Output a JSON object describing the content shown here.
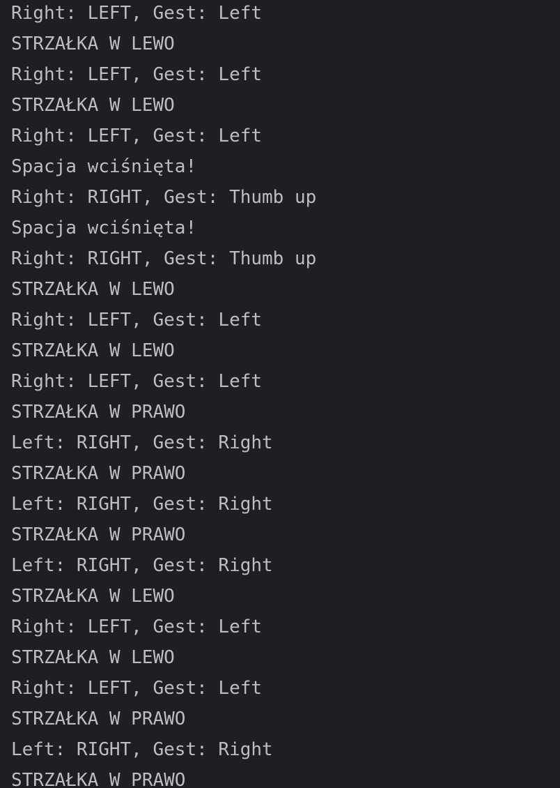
{
  "console": {
    "lines": [
      "Right: LEFT, Gest: Left",
      "STRZAŁKA W LEWO",
      "Right: LEFT, Gest: Left",
      "STRZAŁKA W LEWO",
      "Right: LEFT, Gest: Left",
      "Spacja wciśnięta!",
      "Right: RIGHT, Gest: Thumb up",
      "Spacja wciśnięta!",
      "Right: RIGHT, Gest: Thumb up",
      "STRZAŁKA W LEWO",
      "Right: LEFT, Gest: Left",
      "STRZAŁKA W LEWO",
      "Right: LEFT, Gest: Left",
      "STRZAŁKA W PRAWO",
      "Left: RIGHT, Gest: Right",
      "STRZAŁKA W PRAWO",
      "Left: RIGHT, Gest: Right",
      "STRZAŁKA W PRAWO",
      "Left: RIGHT, Gest: Right",
      "STRZAŁKA W LEWO",
      "Right: LEFT, Gest: Left",
      "STRZAŁKA W LEWO",
      "Right: LEFT, Gest: Left",
      "STRZAŁKA W PRAWO",
      "Left: RIGHT, Gest: Right",
      "STRZAŁKA W PRAWO"
    ]
  },
  "colors": {
    "background": "#1e1f22",
    "text": "#bcbec4"
  }
}
